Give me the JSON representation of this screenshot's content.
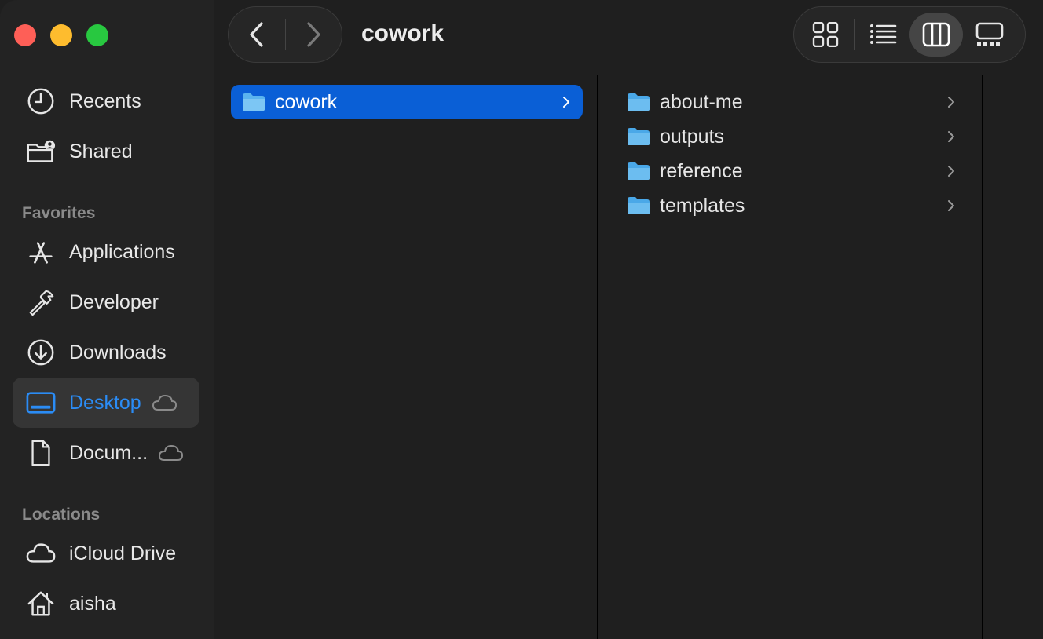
{
  "window": {
    "title": "cowork"
  },
  "sidebar": {
    "top_items": [
      {
        "label": "Recents",
        "icon": "clock-icon"
      },
      {
        "label": "Shared",
        "icon": "shared-folder-icon"
      }
    ],
    "favorites_heading": "Favorites",
    "favorites": [
      {
        "label": "Applications",
        "icon": "applications-icon"
      },
      {
        "label": "Developer",
        "icon": "hammer-icon"
      },
      {
        "label": "Downloads",
        "icon": "download-icon"
      },
      {
        "label": "Desktop",
        "icon": "desktop-icon",
        "selected": true,
        "cloud": true
      },
      {
        "label": "Docum...",
        "icon": "document-icon",
        "cloud": true
      }
    ],
    "locations_heading": "Locations",
    "locations": [
      {
        "label": "iCloud Drive",
        "icon": "cloud-icon"
      },
      {
        "label": "aisha",
        "icon": "home-icon"
      }
    ]
  },
  "columns": {
    "col1": [
      {
        "label": "cowork",
        "selected": true
      }
    ],
    "col2": [
      {
        "label": "about-me"
      },
      {
        "label": "outputs"
      },
      {
        "label": "reference"
      },
      {
        "label": "templates"
      }
    ]
  },
  "colors": {
    "accent": "#0a5fd6",
    "sidebar_selected_text": "#2b8cf5",
    "folder": "#5ab4ef"
  }
}
